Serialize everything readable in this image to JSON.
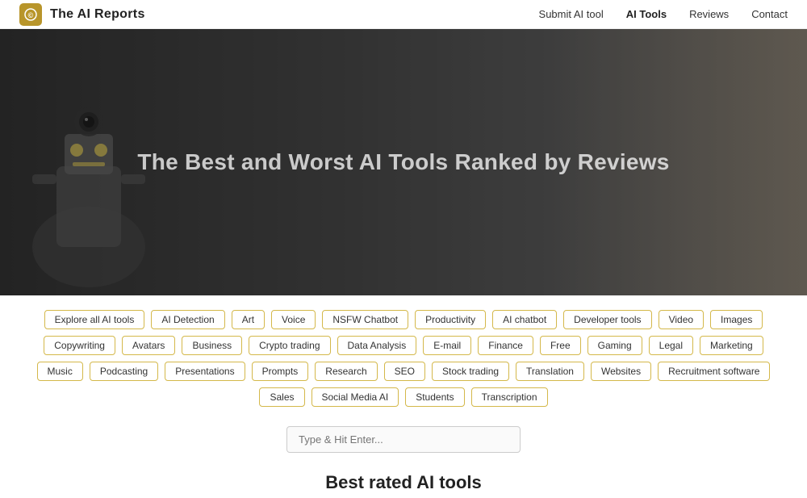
{
  "header": {
    "logo_letter": "©",
    "logo_text": "The AI Reports",
    "nav": [
      {
        "label": "Submit AI tool",
        "active": false
      },
      {
        "label": "AI Tools",
        "active": true
      },
      {
        "label": "Reviews",
        "active": false
      },
      {
        "label": "Contact",
        "active": false
      }
    ]
  },
  "hero": {
    "title": "The Best and Worst AI Tools Ranked by Reviews"
  },
  "tags": {
    "items": [
      "Explore all AI tools",
      "AI Detection",
      "Art",
      "Voice",
      "NSFW Chatbot",
      "Productivity",
      "AI chatbot",
      "Developer tools",
      "Video",
      "Images",
      "Copywriting",
      "Avatars",
      "Business",
      "Crypto trading",
      "Data Analysis",
      "E-mail",
      "Finance",
      "Free",
      "Gaming",
      "Legal",
      "Marketing",
      "Music",
      "Podcasting",
      "Presentations",
      "Prompts",
      "Research",
      "SEO",
      "Stock trading",
      "Translation",
      "Websites",
      "Recruitment software",
      "Sales",
      "Social Media AI",
      "Students",
      "Transcription"
    ]
  },
  "search": {
    "placeholder": "Type & Hit Enter..."
  },
  "best_rated": {
    "title": "Best rated AI tools"
  }
}
